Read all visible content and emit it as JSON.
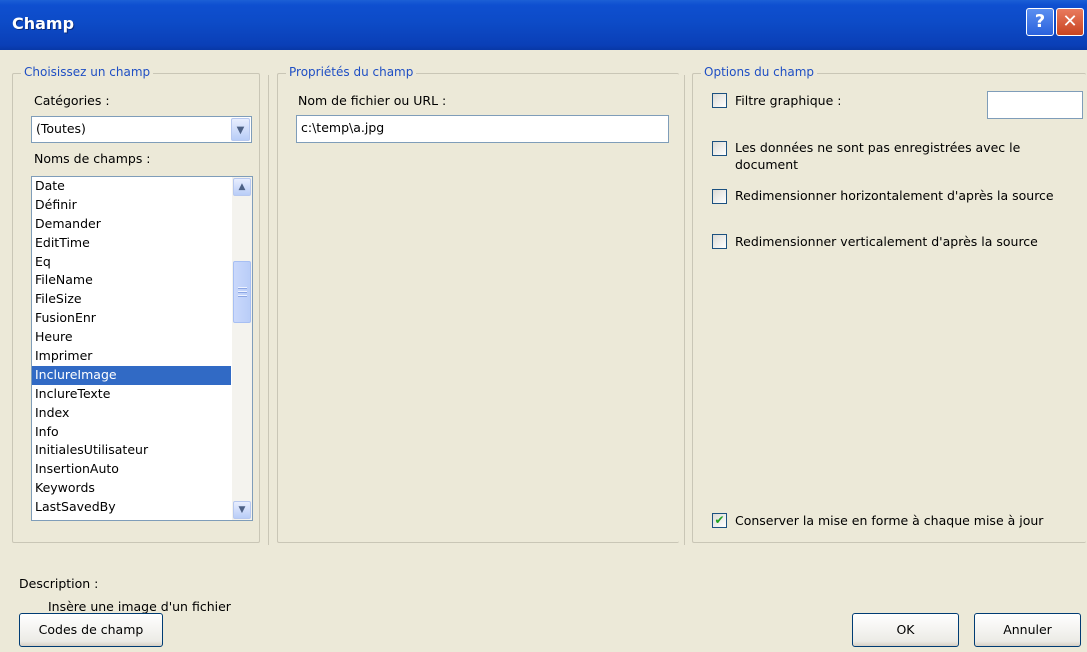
{
  "window": {
    "title": "Champ"
  },
  "title_buttons": {
    "help": "?",
    "close": "✕"
  },
  "choose_field": {
    "group_title": "Choisissez un champ",
    "categories_label": "Catégories :",
    "category_value": "(Toutes)",
    "field_names_label": "Noms de champs :",
    "fields": [
      "Date",
      "Définir",
      "Demander",
      "EditTime",
      "Eq",
      "FileName",
      "FileSize",
      "FusionEnr",
      "Heure",
      "Imprimer",
      "InclureImage",
      "InclureTexte",
      "Index",
      "Info",
      "InitialesUtilisateur",
      "InsertionAuto",
      "Keywords",
      "LastSavedBy"
    ],
    "selected_field": "InclureImage"
  },
  "field_properties": {
    "group_title": "Propriétés du champ",
    "filename_label": "Nom de fichier ou URL :",
    "filename_value": "c:\\temp\\a.jpg"
  },
  "field_options": {
    "group_title": "Options du champ",
    "graphic_filter_label": "Filtre graphique :",
    "graphic_filter_value": "",
    "not_saved_label": "Les données ne sont pas enregistrées avec le document",
    "resize_h_label": "Redimensionner horizontalement d'après la source",
    "resize_v_label": "Redimensionner verticalement d'après la source",
    "preserve_format_label": "Conserver la mise en forme à chaque mise à jour",
    "states": {
      "graphic_filter": false,
      "not_saved": false,
      "resize_h": false,
      "resize_v": false,
      "preserve_format": true
    }
  },
  "description": {
    "label": "Description :",
    "text": "Insère une image d'un fichier"
  },
  "buttons": {
    "field_codes": "Codes de champ",
    "ok": "OK",
    "cancel": "Annuler"
  },
  "colors": {
    "titlebar": "#0d4bc7",
    "group_title": "#1f4fc4",
    "selection": "#316ac5",
    "dialog_bg": "#ece9d8"
  },
  "icons": {
    "dropdown": "chevron-down-icon",
    "scroll_up": "chevron-up-icon",
    "scroll_down": "chevron-down-icon",
    "check": "checkmark-icon"
  }
}
